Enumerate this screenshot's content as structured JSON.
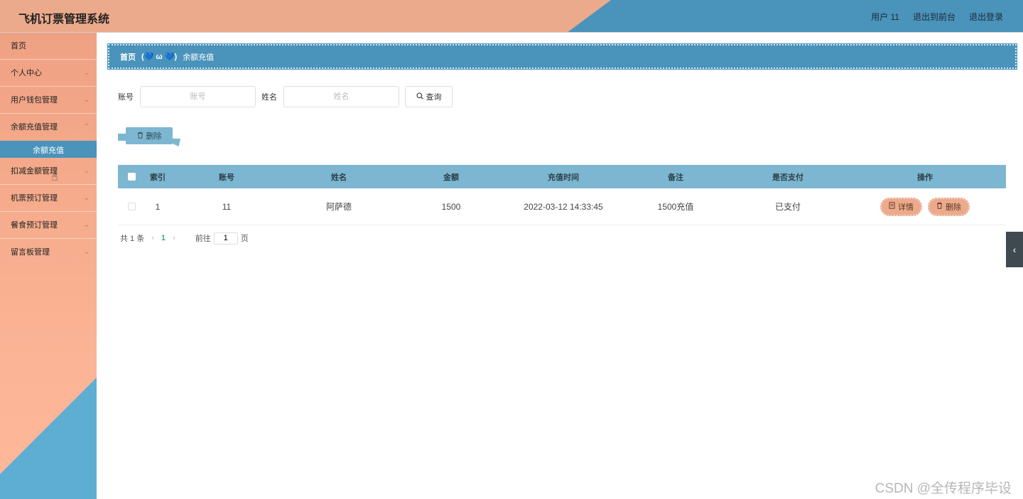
{
  "app": {
    "title": "飞机订票管理系统"
  },
  "header": {
    "user": "用户 11",
    "to_frontend": "退出到前台",
    "logout": "退出登录"
  },
  "sidebar": {
    "items": [
      {
        "label": "首页",
        "expandable": false
      },
      {
        "label": "个人中心",
        "expandable": true
      },
      {
        "label": "用户钱包管理",
        "expandable": true
      },
      {
        "label": "余额充值管理",
        "expandable": true
      },
      {
        "label": "扣减金额管理",
        "expandable": true
      },
      {
        "label": "机票预订管理",
        "expandable": true
      },
      {
        "label": "餐食预订管理",
        "expandable": true
      },
      {
        "label": "留言板管理",
        "expandable": true
      }
    ],
    "active_subitem": "余额充值"
  },
  "breadcrumb": {
    "home": "首页",
    "separator": "(💙 ω 💙)",
    "current": "余额充值"
  },
  "search": {
    "account_label": "账号",
    "account_placeholder": "账号",
    "name_label": "姓名",
    "name_placeholder": "姓名",
    "query_button": "查询"
  },
  "toolbar": {
    "delete_label": "删除"
  },
  "table": {
    "columns": [
      "索引",
      "账号",
      "姓名",
      "金额",
      "充值时间",
      "备注",
      "是否支付",
      "操作"
    ],
    "rows": [
      {
        "index": "1",
        "account": "11",
        "name": "阿萨德",
        "amount": "1500",
        "time": "2022-03-12 14:33:45",
        "remark": "1500充值",
        "paid": "已支付"
      }
    ],
    "detail_button": "详情",
    "delete_button": "删除"
  },
  "pagination": {
    "total": "共 1 条",
    "current_page": "1",
    "goto_label": "前往",
    "goto_value": "1",
    "page_unit": "页"
  },
  "watermark": "CSDN @全传程序毕设",
  "colors": {
    "header_salmon": "#ecaa8c",
    "accent_blue": "#4a93bb",
    "table_header": "#7db6d0",
    "page_active": "#43a47c"
  }
}
